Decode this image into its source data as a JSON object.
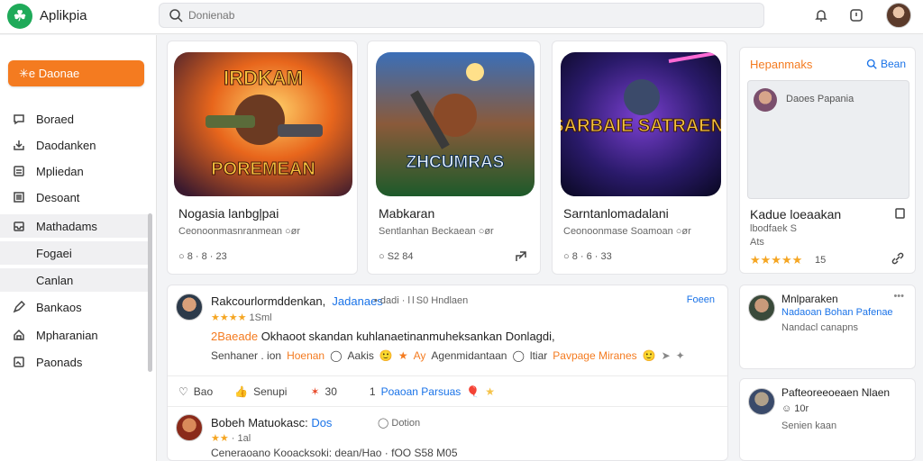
{
  "app": {
    "logo_glyph": "☘",
    "name": "Aplikpia"
  },
  "search": {
    "placeholder": "Donienab"
  },
  "header": {
    "icons": [
      "bell-icon",
      "clock-icon",
      "avatar"
    ]
  },
  "sidebar": {
    "cta": "✳e Daonae",
    "items": [
      {
        "label": "Boraed",
        "icon": "chat-bubble-icon"
      },
      {
        "label": "Daodanken",
        "icon": "download-icon"
      },
      {
        "label": "Mpliedan",
        "icon": "document-icon"
      },
      {
        "label": "Desoant",
        "icon": "list-icon"
      },
      {
        "label": "Mathadams",
        "icon": "inbox-icon"
      },
      {
        "label": "Fogaei",
        "icon": ""
      },
      {
        "label": "Canlan",
        "icon": ""
      },
      {
        "label": "Bankaos",
        "icon": "pen-icon"
      },
      {
        "label": "Mpharanian",
        "icon": "house-icon"
      },
      {
        "label": "Paonads",
        "icon": "image-icon"
      }
    ]
  },
  "games": [
    {
      "art_title": "IRDKAM",
      "art_sub": "POREMEAN",
      "title": "Nogasia lanbgļpai",
      "sub": "Ceonoonmasnranmean  ○ør",
      "stats": "○  8 · 8 · 23"
    },
    {
      "art_title": "ZHCUMRAS",
      "art_sub": "",
      "title": "Mabkaran",
      "sub": "Sentlanhan  Beckaean  ○ør",
      "stats": "○  S2  84"
    },
    {
      "art_title": "SARBAIE SATRAEN!",
      "art_sub": "",
      "title": "Sarntanlomadalani",
      "sub": "Ceonoonmase  Soamoan  ○ør",
      "stats": "○  8 · 6 · 33"
    }
  ],
  "right_panel": {
    "heading": "Hepanmaks",
    "link": "Bean",
    "preview_name": "Daoes Papania",
    "title": "Kadue loeaakan",
    "line1": "lbodfaek S",
    "line2": "Ats",
    "stars": "★★★★★",
    "rating": "15"
  },
  "feed": {
    "badge": "Foeen",
    "posts": [
      {
        "author": "Rakcourlormddenkan,",
        "tag": "Jadanaes",
        "meta": "•  dadi · l l S0  Hndlaen",
        "stars": "★★★★",
        "rating_val": "1Sml",
        "body_hl": "2Baeade",
        "body": "Okhaoot skandan kuhlanaetinanmuheksankan Donlagdi,",
        "actions": {
          "a1": "Senhaner . ion",
          "a2": "Hoenan",
          "a3": "Aakis",
          "a4": "Ay",
          "a5": "Agenmidantaan",
          "a6": "ltiar",
          "a7": "Pavpage Miranes"
        }
      },
      {
        "footer": {
          "like": "Bao",
          "save": "Senupi",
          "count": "30",
          "num": "1",
          "tag": "Poaoan Parsuas"
        }
      },
      {
        "author": "Bobeh Matuokasc:",
        "tag": "Dos",
        "meta": "Dotion",
        "stars": "★★",
        "rating_val": "· 1al",
        "body": "Ceneraoano Kooacksoki: dean/Hao  · fOO  S58 M05"
      }
    ]
  },
  "side_cards": [
    {
      "name": "Mnlparaken",
      "handle": "Nadaoan  Bohan Pafenae",
      "note": "Nandacl canapns",
      "dots": "•••"
    },
    {
      "name": "Pafteoreeoeaen Nlaen",
      "handle": "",
      "note_emoji": "☺ 10r",
      "note": "Senien kaan",
      "dots": ""
    }
  ]
}
